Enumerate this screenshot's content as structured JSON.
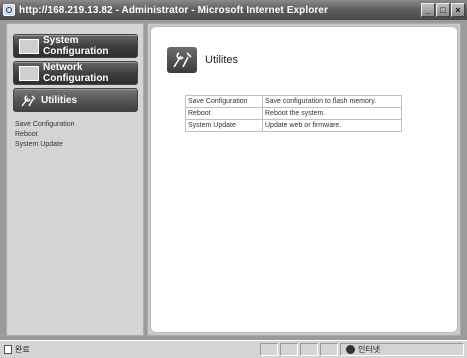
{
  "window": {
    "title": "http://168.219.13.82 - Administrator - Microsoft Internet Explorer",
    "buttons": [
      "_",
      "□",
      "×"
    ]
  },
  "sidebar": {
    "nav": [
      {
        "label": "System Configuration",
        "icon": "system-config-icon"
      },
      {
        "label": "Network Configuration",
        "icon": "network-config-icon"
      },
      {
        "label": "Utilities",
        "icon": "wrench-icon"
      }
    ],
    "links": [
      "Save Configuration",
      "Reboot",
      "System Update"
    ]
  },
  "main": {
    "title": "Utilites",
    "rows": [
      {
        "name": "Save Configuration",
        "desc": "Save configuration to flash memory."
      },
      {
        "name": "Reboot",
        "desc": "Reboot the system."
      },
      {
        "name": "System Update",
        "desc": "Update web or firmware."
      }
    ]
  },
  "status": {
    "left": "완료",
    "zone": "인터넷"
  },
  "colors": {
    "nav_button": "#3d3d3d",
    "frame": "#9b9b9b"
  }
}
